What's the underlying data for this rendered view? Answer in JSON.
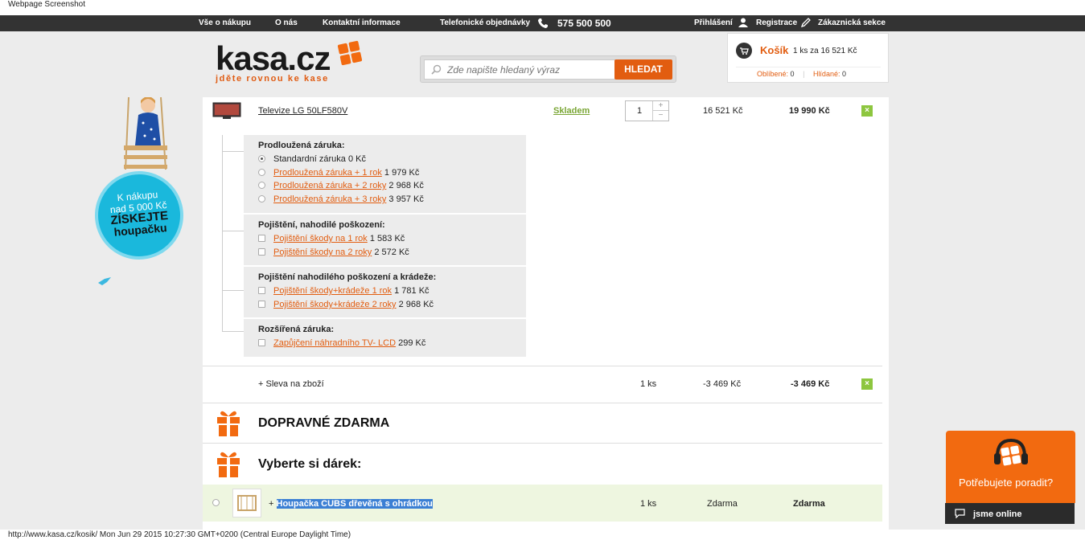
{
  "caption": "Webpage Screenshot",
  "footer_caption": "http://www.kasa.cz/kosik/ Mon Jun 29 2015 10:27:30 GMT+0200 (Central Europe Daylight Time)",
  "topnav": {
    "all_about": "Vše o nákupu",
    "about_us": "O nás",
    "contact": "Kontaktní informace",
    "phone_label": "Telefonické objednávky",
    "phone_number": "575 500 500",
    "login": "Přihlášení",
    "register": "Registrace",
    "customer": "Zákaznická sekce"
  },
  "logo": {
    "word": "kasa.cz",
    "tagline": "jděte rovnou ke kase"
  },
  "search": {
    "placeholder": "Zde napište hledaný výraz",
    "button": "HLEDAT"
  },
  "cart": {
    "title": "Košík",
    "summary": "1 ks za 16 521 Kč",
    "favorites_label": "Oblíbené:",
    "favorites_count": "0",
    "watched_label": "Hlídané:",
    "watched_count": "0"
  },
  "promo": {
    "line1": "K nákupu",
    "line2": "nad 5 000 Kč",
    "line3": "ZÍSKEJTE",
    "line4": "houpačku"
  },
  "product": {
    "name": "Televize LG 50LF580V",
    "stock": "Skladem",
    "qty": "1",
    "price_unit": "16 521 Kč",
    "price_total": "19 990 Kč"
  },
  "options": {
    "warranty_title": "Prodloužená záruka:",
    "warranty_standard": "Standardní záruka 0 Kč",
    "w1_label": "Prodloužená záruka + 1 rok",
    "w1_price": "1 979 Kč",
    "w2_label": "Prodloužená záruka + 2 roky",
    "w2_price": "2 968 Kč",
    "w3_label": "Prodloužená záruka + 3 roky",
    "w3_price": "3 957 Kč",
    "ins_title": "Pojištění, nahodilé poškození:",
    "i1_label": "Pojištění škody na 1 rok",
    "i1_price": "1 583 Kč",
    "i2_label": "Pojištění škody na 2 roky",
    "i2_price": "2 572 Kč",
    "theft_title": "Pojištění nahodilého poškození a krádeže:",
    "t1_label": "Pojištění škody+krádeže 1 rok",
    "t1_price": "1 781 Kč",
    "t2_label": "Pojištění škody+krádeže 2 roky",
    "t2_price": "2 968 Kč",
    "ext_title": "Rozšířená záruka:",
    "e1_label": "Zapůjčení náhradního TV- LCD",
    "e1_price": "299 Kč"
  },
  "discount": {
    "label": "+ Sleva na zboží",
    "qty": "1 ks",
    "unit": "-3 469 Kč",
    "total": "-3 469 Kč"
  },
  "free_shipping": "DOPRAVNÉ ZDARMA",
  "gift_title": "Vyberte si dárek:",
  "gift": {
    "plus": "+",
    "name": "Houpačka CUBS dřevěná s ohrádkou",
    "qty": "1 ks",
    "unit": "Zdarma",
    "total": "Zdarma"
  },
  "help": {
    "text": "Potřebujete poradit?",
    "online": "jsme online"
  },
  "colors": {
    "accent": "#e25d10",
    "dark": "#333333",
    "green": "#8dc63f"
  }
}
